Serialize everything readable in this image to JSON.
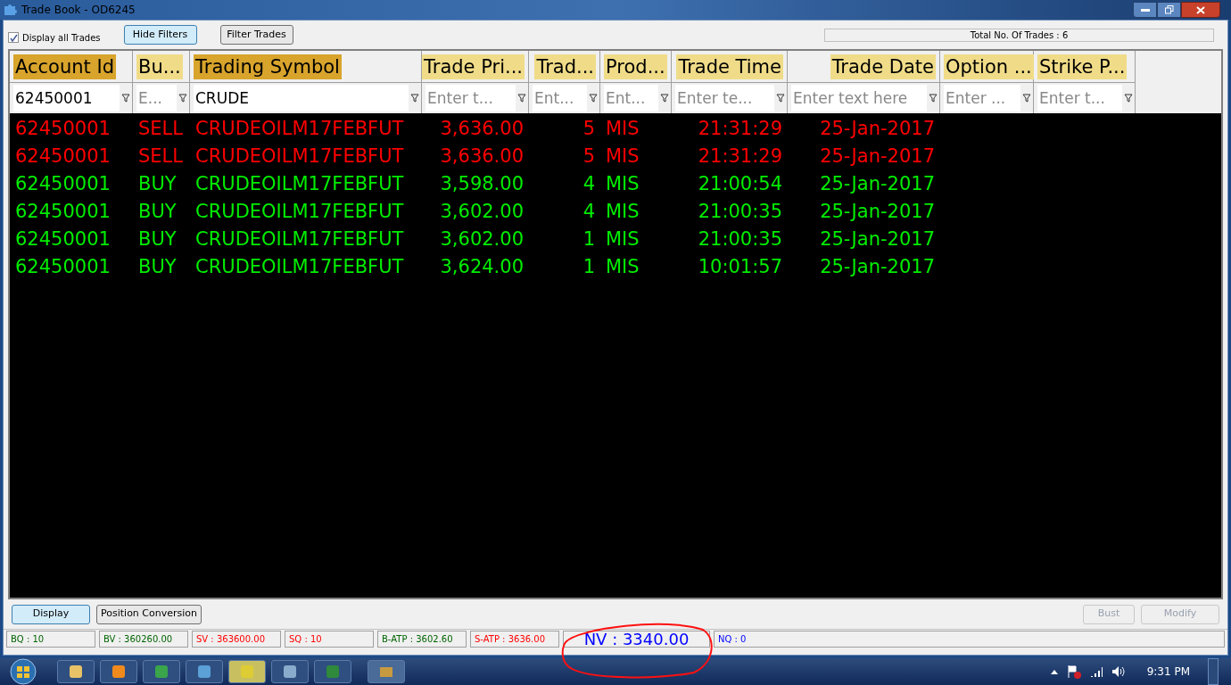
{
  "window": {
    "title": "Trade Book - OD6245"
  },
  "toolbar": {
    "display_all": {
      "label": "Display all Trades",
      "checked": true
    },
    "buttons": [
      {
        "label": "Hide Filters",
        "selected": true
      },
      {
        "label": "Filter Trades",
        "selected": false
      }
    ],
    "total": "Total No. Of Trades : 6"
  },
  "table": {
    "columns": [
      {
        "label": "Account Id",
        "highlighted": true,
        "filter": {
          "value": "62450001"
        }
      },
      {
        "label": "Bu...",
        "highlighted": false,
        "filter": {
          "placeholder": "E..."
        }
      },
      {
        "label": "Trading Symbol",
        "highlighted": true,
        "filter": {
          "value": "CRUDE"
        }
      },
      {
        "label": "Trade Pri...",
        "highlighted": false,
        "filter": {
          "placeholder": "Enter t..."
        }
      },
      {
        "label": "Trad...",
        "highlighted": false,
        "filter": {
          "placeholder": "Ent..."
        }
      },
      {
        "label": "Prod...",
        "highlighted": false,
        "filter": {
          "placeholder": "Ent..."
        }
      },
      {
        "label": "Trade Time",
        "highlighted": false,
        "filter": {
          "placeholder": "Enter te..."
        }
      },
      {
        "label": "Trade Date",
        "highlighted": false,
        "filter": {
          "placeholder": "Enter text here"
        }
      },
      {
        "label": "Option ...",
        "highlighted": false,
        "filter": {
          "placeholder": "Enter ..."
        }
      },
      {
        "label": "Strike P...",
        "highlighted": false,
        "filter": {
          "placeholder": "Enter t..."
        }
      }
    ],
    "rows": [
      {
        "kind": "sell",
        "cells": [
          "62450001",
          "SELL",
          "CRUDEOILM17FEBFUT",
          "3,636.00",
          "5",
          "MIS",
          "21:31:29",
          "25-Jan-2017"
        ]
      },
      {
        "kind": "sell",
        "cells": [
          "62450001",
          "SELL",
          "CRUDEOILM17FEBFUT",
          "3,636.00",
          "5",
          "MIS",
          "21:31:29",
          "25-Jan-2017"
        ]
      },
      {
        "kind": "buy",
        "cells": [
          "62450001",
          "BUY",
          "CRUDEOILM17FEBFUT",
          "3,598.00",
          "4",
          "MIS",
          "21:00:54",
          "25-Jan-2017"
        ]
      },
      {
        "kind": "buy",
        "cells": [
          "62450001",
          "BUY",
          "CRUDEOILM17FEBFUT",
          "3,602.00",
          "4",
          "MIS",
          "21:00:35",
          "25-Jan-2017"
        ]
      },
      {
        "kind": "buy",
        "cells": [
          "62450001",
          "BUY",
          "CRUDEOILM17FEBFUT",
          "3,602.00",
          "1",
          "MIS",
          "21:00:35",
          "25-Jan-2017"
        ]
      },
      {
        "kind": "buy",
        "cells": [
          "62450001",
          "BUY",
          "CRUDEOILM17FEBFUT",
          "3,624.00",
          "1",
          "MIS",
          "10:01:57",
          "25-Jan-2017"
        ]
      }
    ]
  },
  "actions": [
    {
      "label": "Display",
      "selected": true,
      "disabled": false
    },
    {
      "label": "Position Conversion",
      "selected": false,
      "disabled": false
    },
    {
      "label": "Bust",
      "disabled": true
    },
    {
      "label": "Modify",
      "disabled": true
    }
  ],
  "status_bar": [
    {
      "text": "BQ : 10",
      "color": "#006400"
    },
    {
      "text": "BV : 360260.00",
      "color": "#006400"
    },
    {
      "text": "SV : 363600.00",
      "color": "#ff0000"
    },
    {
      "text": "SQ : 10",
      "color": "#ff0000"
    },
    {
      "text": "B-ATP : 3602.60",
      "color": "#006400"
    },
    {
      "text": "S-ATP : 3636.00",
      "color": "#ff0000"
    },
    {
      "text": "NV : 3340.00",
      "color": "#0000ff",
      "large": true
    },
    {
      "text": "NQ : 0",
      "color": "#0000ff",
      "large": false
    }
  ],
  "taskbar": {
    "clock": "9:31 PM"
  }
}
